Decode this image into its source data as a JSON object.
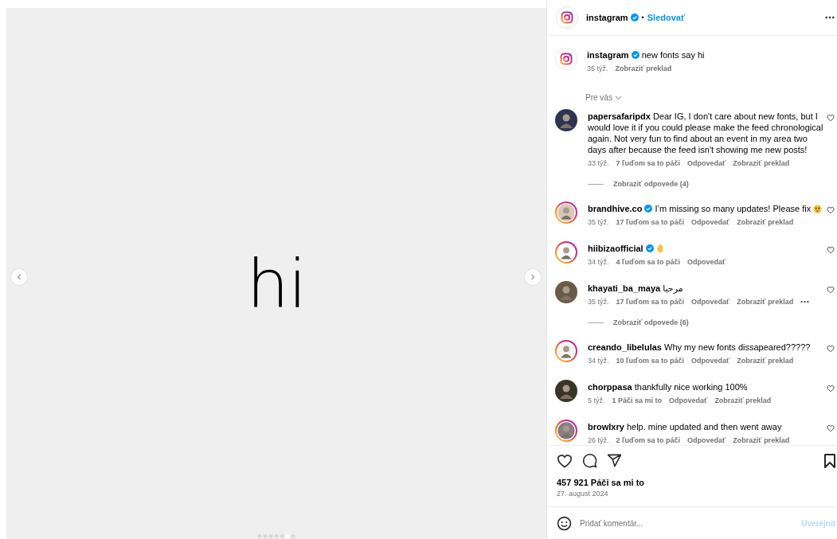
{
  "post": {
    "media_text": "hi",
    "carousel_dots": [
      {
        "selected": false
      },
      {
        "selected": false
      },
      {
        "selected": false
      },
      {
        "selected": false
      },
      {
        "selected": false
      },
      {
        "selected": true
      },
      {
        "selected": false
      }
    ]
  },
  "header": {
    "username": "instagram",
    "verified": true,
    "separator": "•",
    "follow": "Sledovať"
  },
  "caption": {
    "username": "instagram",
    "verified": true,
    "text": "new fonts say hi",
    "time": "35 týž.",
    "translate": "Zobraziť preklad"
  },
  "sort": {
    "label": "Pre vás"
  },
  "comments": [
    {
      "username": "papersafaripdx",
      "verified": false,
      "ring": false,
      "text": "Dear IG, I don't care about new fonts, but I would love it if you could please make the feed chronological again. Not very fun to find about an event in my area two days after because the feed isn't showing me new posts!",
      "time": "33 týž.",
      "likes": "7 ľuďom sa to páči",
      "reply": "Odpovedať",
      "translate": "Zobraziť preklad",
      "more": false,
      "replies": "Zobraziť odpovede (4)"
    },
    {
      "username": "brandhive.co",
      "verified": true,
      "ring": true,
      "text": "I’m missing so many updates! Please fix",
      "kind": "face_emoji",
      "time": "35 týž.",
      "likes": "17 ľuďom sa to páči",
      "reply": "Odpovedať",
      "translate": "Zobraziť preklad",
      "more": false
    },
    {
      "username": "hiibizaofficial",
      "verified": true,
      "ring": true,
      "kind": "hand_emoji",
      "time": "34 týž.",
      "likes": "4 ľuďom sa to páči",
      "reply": "Odpovedať",
      "more": false
    },
    {
      "username": "khayati_ba_maya",
      "verified": false,
      "ring": false,
      "text": "مرحبا",
      "time": "35 týž.",
      "likes": "17 ľuďom sa to páči",
      "reply": "Odpovedať",
      "translate": "Zobraziť preklad",
      "more": true,
      "replies": "Zobraziť odpovede (6)"
    },
    {
      "username": "creando_libelulas",
      "verified": false,
      "ring": true,
      "text": "Why my new fonts dissapeared?????",
      "time": "34 týž.",
      "likes": "10 ľuďom sa to páči",
      "reply": "Odpovedať",
      "translate": "Zobraziť preklad",
      "more": false
    },
    {
      "username": "chorppasa",
      "verified": false,
      "ring": false,
      "text": "thankfully nice working 100%",
      "time": "5 týž.",
      "likes": "1 Páči sa mi to",
      "reply": "Odpovedať",
      "translate": "Zobraziť preklad",
      "more": false
    },
    {
      "username": "browlxry",
      "verified": false,
      "ring": true,
      "text": "help. mine updated and then went away",
      "time": "26 týž.",
      "likes": "2 ľuďom sa to páči",
      "reply": "Odpovedať",
      "translate": "Zobraziť preklad",
      "more": false
    }
  ],
  "likes": "457 921 Páči sa mi to",
  "date": "27. august 2024",
  "comment_field": {
    "placeholder": "Pridať komentár...",
    "post": "Uverejnit"
  }
}
